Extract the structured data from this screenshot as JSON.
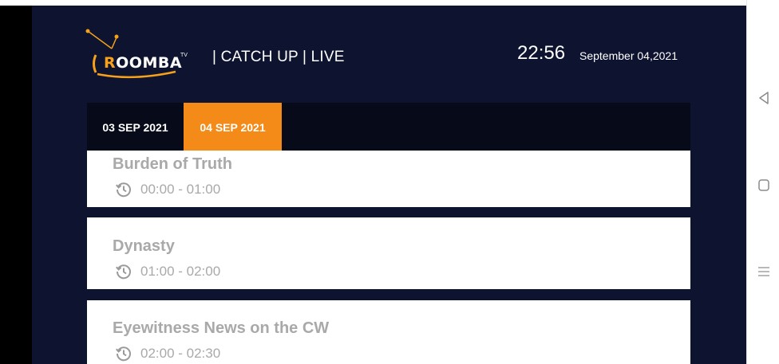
{
  "header": {
    "logo_text": "ROOMBA",
    "logo_badge": "TV",
    "nav_title": "| CATCH UP | LIVE",
    "clock": "22:56",
    "date": "September 04,2021"
  },
  "tabs": [
    {
      "label": "03 SEP 2021",
      "active": false
    },
    {
      "label": "04 SEP 2021",
      "active": true
    }
  ],
  "programs": [
    {
      "title": "Burden of Truth",
      "time": "00:00 - 01:00"
    },
    {
      "title": "Dynasty",
      "time": "01:00 - 02:00"
    },
    {
      "title": "Eyewitness News on the CW",
      "time": "02:00 - 02:30"
    }
  ],
  "colors": {
    "background": "#0e1330",
    "tab_bar": "#070a18",
    "accent": "#f48a17",
    "card": "#ffffff",
    "muted_text": "#a9a9a9"
  },
  "icons": {
    "program_time": "history-clock-icon",
    "system_nav": [
      "back-triangle-icon",
      "home-square-icon",
      "menu-lines-icon"
    ]
  }
}
